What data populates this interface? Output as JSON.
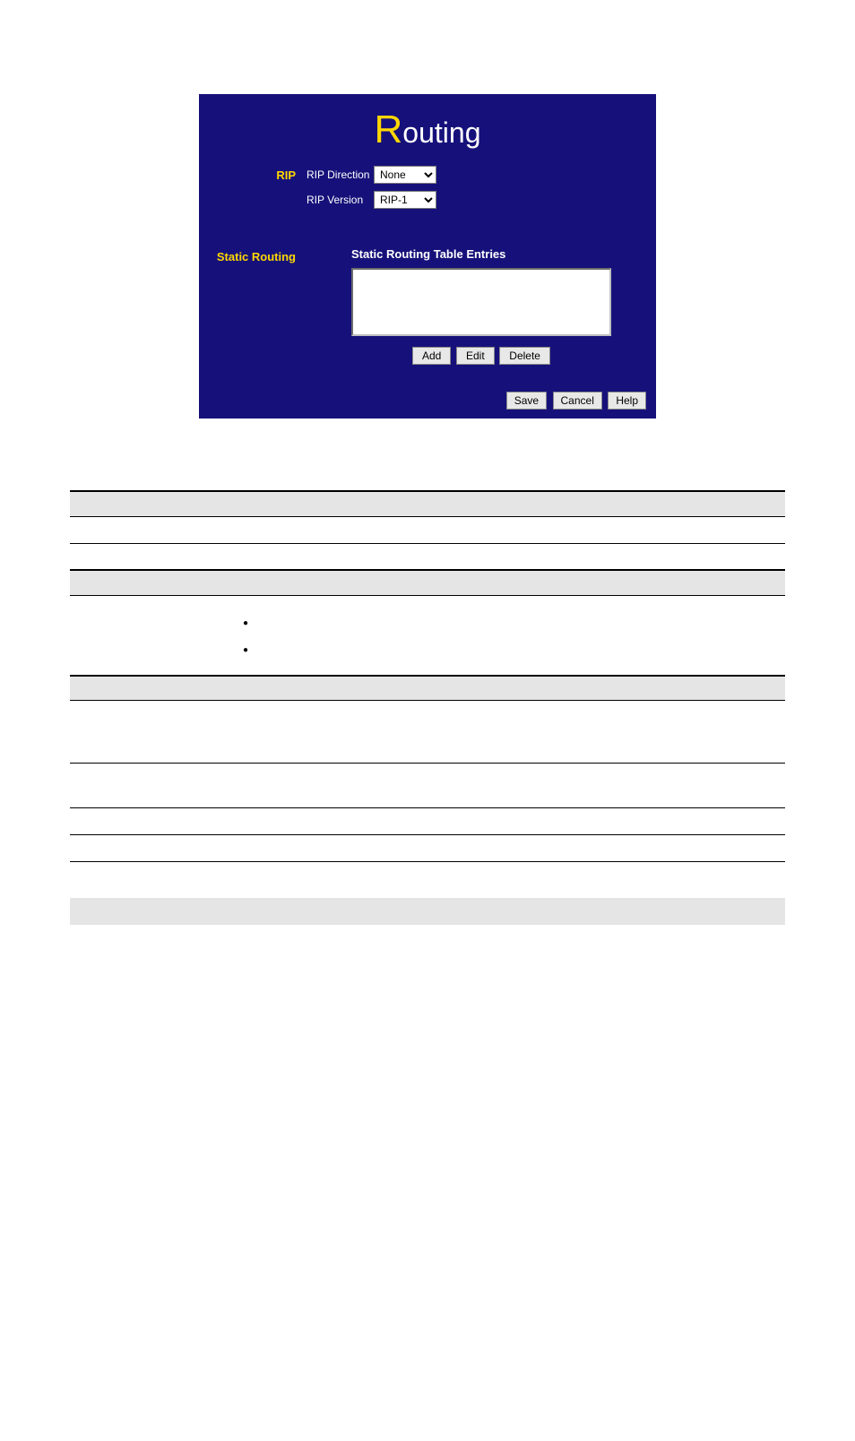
{
  "panel": {
    "title_first": "R",
    "title_rest": "outing",
    "rip": {
      "label": "RIP",
      "direction_label": "RIP Direction",
      "direction_value": "None",
      "version_label": "RIP Version",
      "version_value": "RIP-1"
    },
    "static_routing": {
      "label": "Static Routing",
      "entries_label": "Static Routing Table Entries",
      "add_btn": "Add",
      "edit_btn": "Edit",
      "delete_btn": "Delete"
    },
    "footer": {
      "save_btn": "Save",
      "cancel_btn": "Cancel",
      "help_btn": "Help"
    }
  }
}
